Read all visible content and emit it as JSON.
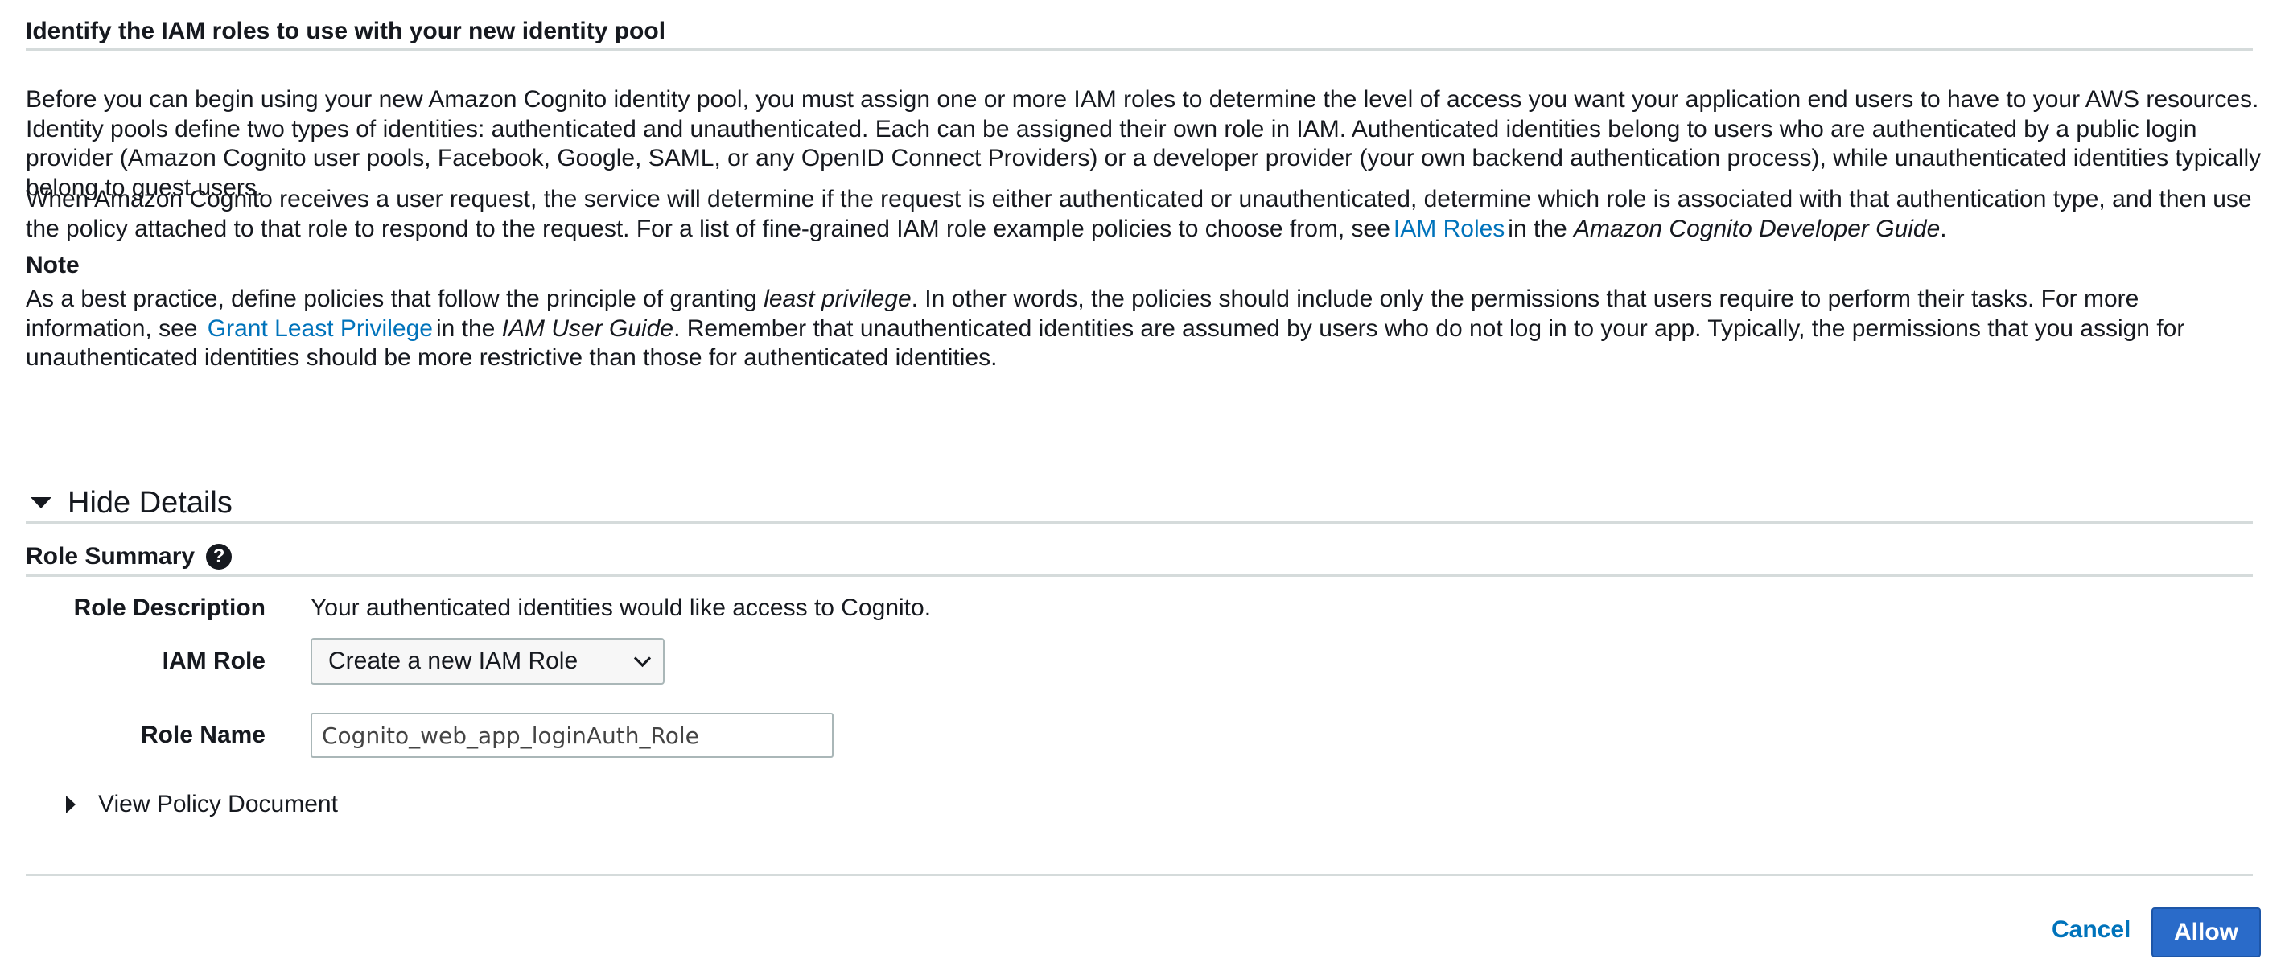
{
  "section_title": "Identify the IAM roles to use with your new identity pool",
  "intro": {
    "p1": "Before you can begin using your new Amazon Cognito identity pool, you must assign one or more IAM roles to determine the level of access you want your application end users to have to your AWS resources. Identity pools define two types of identities: authenticated and unauthenticated. Each can be assigned their own role in IAM. Authenticated identities belong to users who are authenticated by a public login provider (Amazon Cognito user pools, Facebook, Google, SAML, or any OpenID Connect Providers) or a developer provider (your own backend authentication process), while unauthenticated identities typically belong to guest users.",
    "p2_before": "When Amazon Cognito receives a user request, the service will determine if the request is either authenticated or unauthenticated, determine which role is associated with that authentication type, and then use the policy attached to that role to respond to the request. For a list of fine-grained IAM role example policies to choose from, see",
    "p2_link": "IAM Roles",
    "p2_mid": "in the",
    "p2_guide": "Amazon Cognito Developer Guide",
    "p2_end": "."
  },
  "note": {
    "label": "Note",
    "before": "As a best practice, define policies that follow the principle of granting",
    "emphasis": "least privilege",
    "after": ". In other words, the policies should include only the permissions that users require to perform their tasks. For more information, see",
    "link": "Grant Least Privilege",
    "mid": "in the",
    "guide": "IAM User Guide",
    "end": ". Remember that unauthenticated identities are assumed by users who do not log in to your app. Typically, the permissions that you assign for unauthenticated identities should be more restrictive than those for authenticated identities."
  },
  "details": {
    "toggle_label": "Hide Details",
    "role_summary_title": "Role Summary",
    "help_icon": "question-circle-icon",
    "rows": {
      "description_label": "Role Description",
      "description_value": "Your authenticated identities would like access to Cognito.",
      "iam_role_label": "IAM Role",
      "iam_role_selected": "Create a new IAM Role",
      "role_name_label": "Role Name",
      "role_name_value": "Cognito_web_app_loginAuth_Role"
    },
    "policy_toggle_label": "View Policy Document"
  },
  "footer": {
    "cancel_label": "Cancel",
    "allow_label": "Allow"
  },
  "colors": {
    "link": "#0073bb",
    "primary_button": "#2a6bc9",
    "divider": "#d5dbdb"
  }
}
